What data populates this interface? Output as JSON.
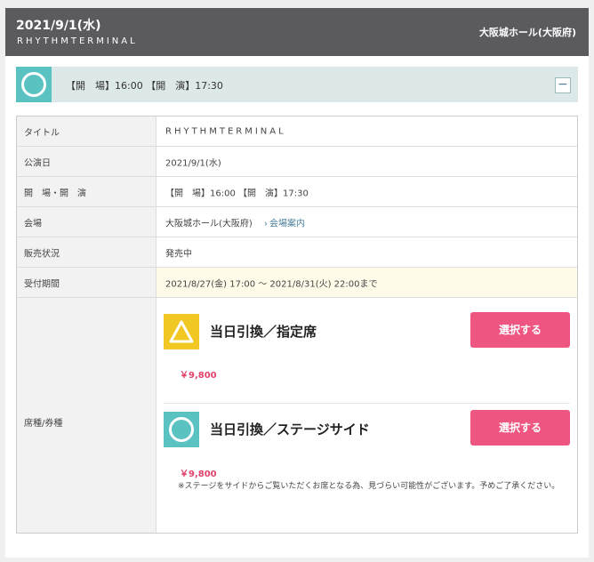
{
  "header": {
    "date": "2021/9/1(水)",
    "artist": "RHYTHMTERMINAL",
    "venue": "大阪城ホール(大阪府)"
  },
  "performance_bar": {
    "icon": "circle-mark-icon",
    "text": "【開　場】16:00 【開　演】17:30",
    "toggle": "−"
  },
  "details": {
    "title_label": "タイトル",
    "title_value": "RHYTHMTERMINAL",
    "date_label": "公演日",
    "date_value": "2021/9/1(水)",
    "time_label": "開　場・開　演",
    "time_value": "【開　場】16:00 【開　演】17:30",
    "venue_label": "会場",
    "venue_value": "大阪城ホール(大阪府)",
    "venue_link": "会場案内",
    "status_label": "販売状況",
    "status_value": "発売中",
    "period_label": "受付期間",
    "period_value": "2021/8/27(金) 17:00 〜 2021/8/31(火) 22:00まで",
    "seats_label": "席種/券種"
  },
  "tickets": [
    {
      "icon": "triangle-mark-icon",
      "name": "当日引換／指定席",
      "button": "選択する",
      "price": "￥9,800",
      "note": ""
    },
    {
      "icon": "circle-mark-icon",
      "name": "当日引換／ステージサイド",
      "button": "選択する",
      "price": "￥9,800",
      "note": "※ステージをサイドからご覧いただくお席となる為、見づらい可能性がございます。予めご了承ください。"
    }
  ],
  "colors": {
    "header_bg": "#5a5a5f",
    "bar_bg": "#dde8e8",
    "circle_mark": "#5bc2c2",
    "triangle_mark": "#f1c823",
    "select_button": "#ee5580",
    "price_text": "#e0426a",
    "link": "#4a7f9a"
  }
}
